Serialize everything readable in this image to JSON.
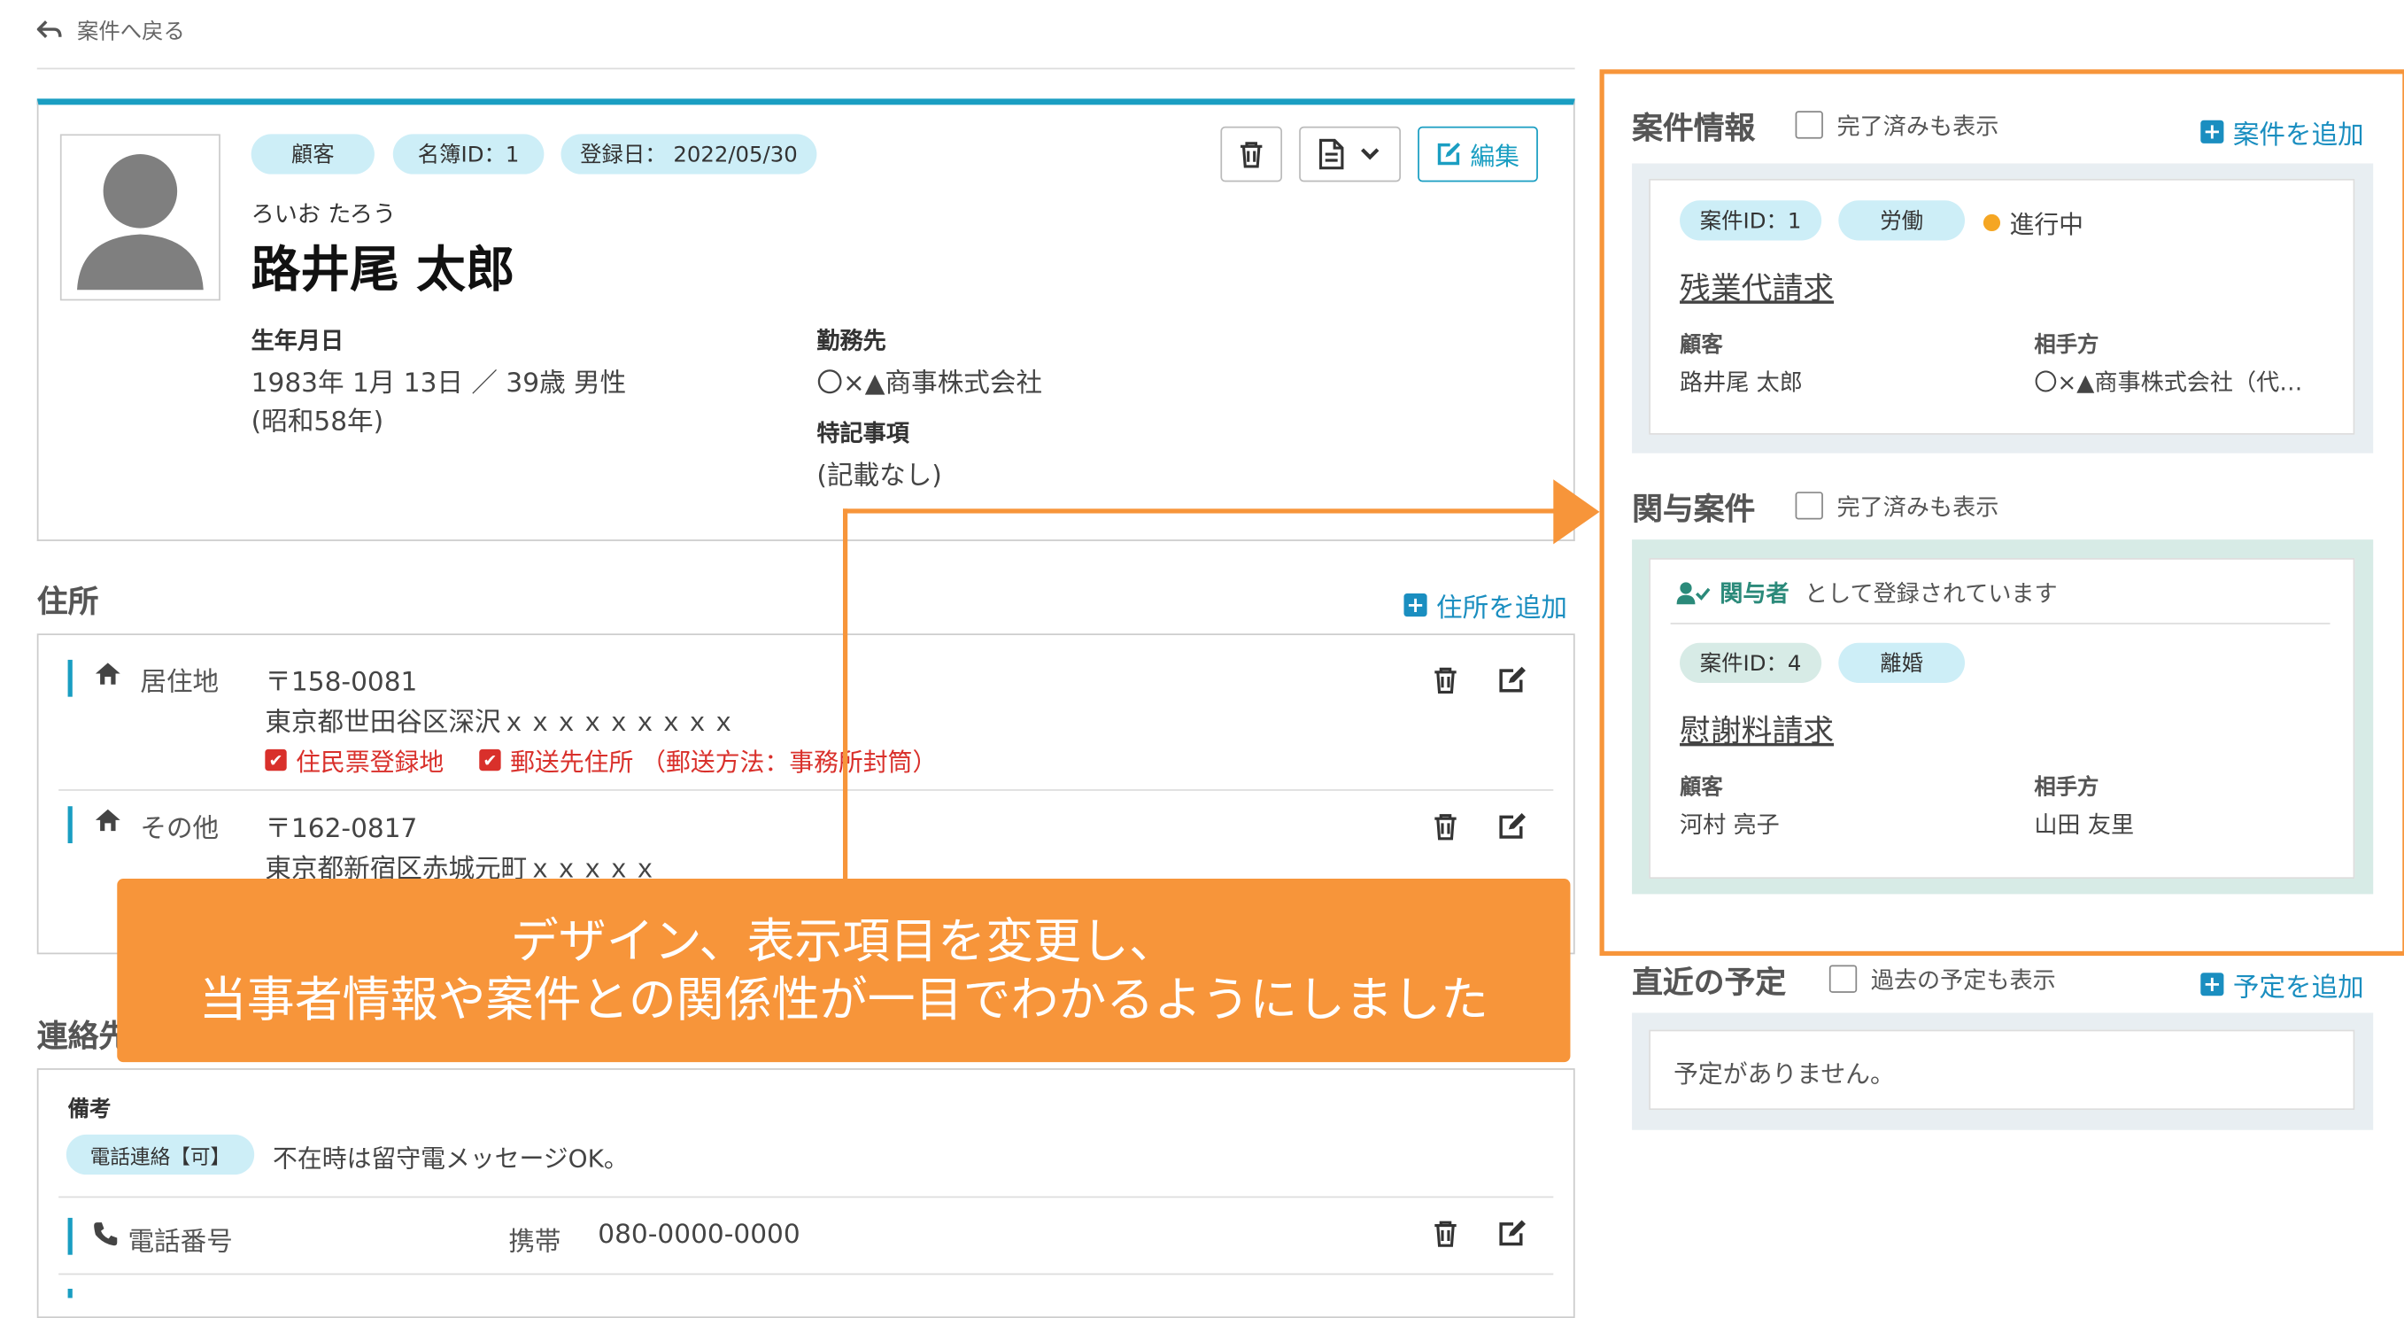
{
  "nav": {
    "back_label": "案件へ戻る"
  },
  "profile": {
    "badges": {
      "type": "顧客",
      "id": "名簿ID：1",
      "registered": "登録日： 2022/05/30"
    },
    "kana": "ろいお たろう",
    "name": "路井尾 太郎",
    "birth_label": "生年月日",
    "birth_value": "1983年 1月 13日 ／ 39歳 男性",
    "birth_era": "(昭和58年)",
    "work_label": "勤務先",
    "work_value": "〇×▲商事株式会社",
    "notes_label": "特記事項",
    "notes_value": "(記載なし)",
    "edit_label": "編集"
  },
  "address": {
    "title": "住所",
    "add_label": "住所を追加",
    "items": [
      {
        "type": "居住地",
        "zip": "〒158-0081",
        "line": "東京都世田谷区深沢ｘｘｘｘｘｘｘｘｘ",
        "flag1": "住民票登録地",
        "flag2": "郵送先住所 （郵送方法：事務所封筒）"
      },
      {
        "type": "その他",
        "zip": "〒162-0817",
        "line": "東京都新宿区赤城元町ｘｘｘｘｘ"
      }
    ]
  },
  "contact": {
    "title_partial": "連絡先",
    "memo_label": "備考",
    "phone_badge": "電話連絡【可】",
    "memo_text": "不在時は留守電メッセージOK。",
    "phone_label": "電話番号",
    "phone_kind": "携帯",
    "phone_number": "080-0000-0000"
  },
  "case_info": {
    "title": "案件情報",
    "show_done": "完了済みも表示",
    "add_label": "案件を追加",
    "case": {
      "id": "案件ID：1",
      "category": "労働",
      "status": "進行中",
      "title": "残業代請求",
      "client_label": "顧客",
      "client": "路井尾 太郎",
      "opponent_label": "相手方",
      "opponent": "〇×▲商事株式会社（代…"
    }
  },
  "related": {
    "title": "関与案件",
    "show_done": "完了済みも表示",
    "role": "関与者",
    "role_suffix": "として登録されています",
    "case": {
      "id": "案件ID：4",
      "category": "離婚",
      "title": "慰謝料請求",
      "client_label": "顧客",
      "client": "河村 亮子",
      "opponent_label": "相手方",
      "opponent": "山田 友里"
    }
  },
  "schedule": {
    "title": "直近の予定",
    "show_past": "過去の予定も表示",
    "add_label": "予定を追加",
    "empty": "予定がありません。"
  },
  "annotation": {
    "line1": "デザイン、表示項目を変更し、",
    "line2": "当事者情報や案件との関係性が一目でわかるようにしました"
  },
  "colors": {
    "accent": "#1a9ec2",
    "badge": "#cdeef7",
    "annotation": "#f7953a",
    "alert": "#d9302b",
    "status_dot": "#f5a623"
  },
  "icons": [
    "back-arrow-icon",
    "trash-icon",
    "document-icon",
    "chevron-down-icon",
    "edit-icon",
    "home-icon",
    "plus-icon",
    "phone-icon",
    "user-check-icon",
    "checkbox-icon"
  ]
}
